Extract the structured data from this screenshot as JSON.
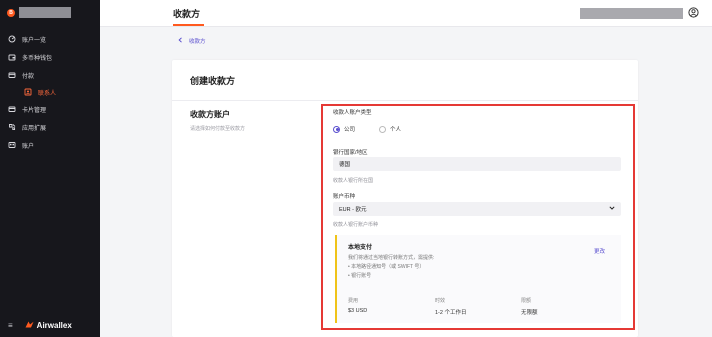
{
  "sidebar": {
    "brand_badge": "B",
    "items": [
      {
        "label": "账户一览",
        "icon": "dashboard-icon"
      },
      {
        "label": "多币种钱包",
        "icon": "wallet-icon"
      },
      {
        "label": "付款",
        "icon": "payments-icon"
      },
      {
        "label": "联系人",
        "icon": "contacts-icon"
      },
      {
        "label": "卡片管理",
        "icon": "card-icon"
      },
      {
        "label": "应用扩展",
        "icon": "apps-icon"
      },
      {
        "label": "账户",
        "icon": "account-icon"
      }
    ],
    "logo_text": "Airwallex"
  },
  "header": {
    "page_title": "收款方"
  },
  "breadcrumb": {
    "back_label": "收款方"
  },
  "card": {
    "title": "创建收款方",
    "section_title": "收款方账户",
    "section_desc": "请选择如何付款至收款方"
  },
  "form": {
    "account_type_label": "收款人账户类型",
    "option_company": "公司",
    "option_individual": "个人",
    "country_label": "银行国家/地区",
    "country_value": "德国",
    "country_hint": "收款人银行所在国",
    "currency_label": "账户币种",
    "currency_value": "EUR - 欧元",
    "currency_hint": "收款人银行账户币种"
  },
  "info": {
    "title": "本地支付",
    "change_label": "更改",
    "line1": "我们将通过当地银行转账方式，需提供:",
    "line2": "• 本地路径通知号（或 SWIFT 号）",
    "line3": "• 银行账号",
    "fee_h": "费用",
    "fee_v": "$3 USD",
    "time_h": "时效",
    "time_v": "1-2 个工作日",
    "limit_h": "限额",
    "limit_v": "无限额"
  },
  "colors": {
    "accent": "#ff5a1f",
    "link": "#5a4fcf",
    "highlight": "#e53935",
    "sidebar_bg": "#17171c"
  }
}
